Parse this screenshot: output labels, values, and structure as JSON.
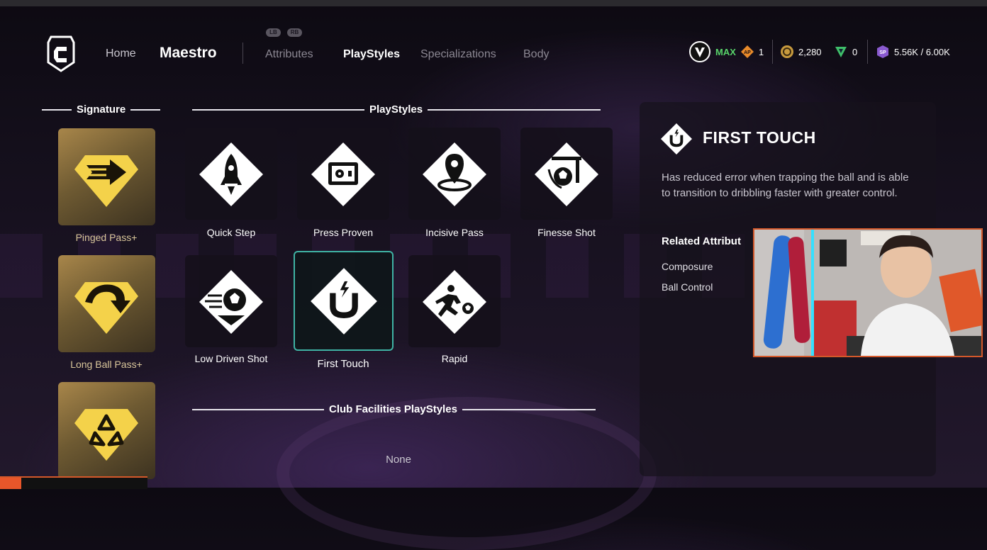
{
  "header": {
    "home_label": "Home",
    "title": "Maestro",
    "bumpers": {
      "left": "LB",
      "right": "RB"
    },
    "tabs": [
      {
        "label": "Attributes",
        "active": false
      },
      {
        "label": "PlayStyles",
        "active": true
      },
      {
        "label": "Specializations",
        "active": false
      },
      {
        "label": "Body",
        "active": false
      }
    ],
    "currencies": {
      "level": "MAX",
      "ap_badge": "AP",
      "ap_value": "1",
      "coins": "2,280",
      "points": "0",
      "sp_badge": "SP",
      "sp_value": "5.56K / 6.00K"
    }
  },
  "signature": {
    "heading": "Signature",
    "items": [
      {
        "label": "Pinged Pass+",
        "icon": "pinged-pass-icon"
      },
      {
        "label": "Long Ball Pass+",
        "icon": "long-ball-pass-icon"
      },
      {
        "label": "",
        "icon": "signature-third-icon"
      }
    ]
  },
  "playstyles": {
    "heading": "PlayStyles",
    "items": [
      {
        "label": "Quick Step",
        "icon": "rocket-icon"
      },
      {
        "label": "Press Proven",
        "icon": "safe-icon"
      },
      {
        "label": "Incisive Pass",
        "icon": "map-pin-icon"
      },
      {
        "label": "Finesse Shot",
        "icon": "finesse-ball-icon"
      },
      {
        "label": "Low Driven Shot",
        "icon": "ball-icon"
      },
      {
        "label": "First Touch",
        "icon": "magnet-icon",
        "selected": true
      },
      {
        "label": "Rapid",
        "icon": "sprinter-icon"
      }
    ]
  },
  "club_facilities": {
    "heading": "Club Facilities PlayStyles",
    "value": "None"
  },
  "detail": {
    "title": "FIRST TOUCH",
    "description": "Has reduced error when trapping the ball and is able to transition to dribbling faster with greater control.",
    "related_heading": "Related Attribut",
    "related": [
      "Composure",
      "Ball Control"
    ]
  },
  "colors": {
    "accent_teal": "#3fb3a4",
    "level_green": "#58d36a",
    "gold": "#d9c69a",
    "webcam_border": "#d4582a"
  }
}
